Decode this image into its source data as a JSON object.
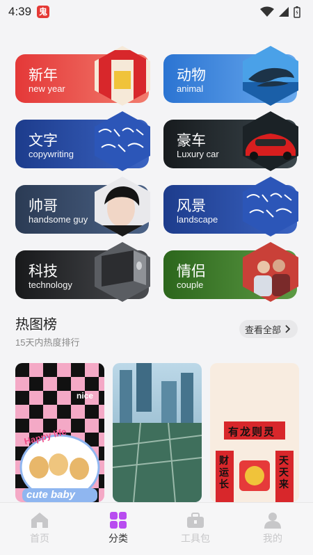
{
  "status_bar": {
    "time": "4:39",
    "app_icon_glyph": "鬼"
  },
  "categories": [
    {
      "title": "新年",
      "subtitle": "new year",
      "colors": [
        "#e63a3a",
        "#f08a7a"
      ],
      "image": "new-year-couplet"
    },
    {
      "title": "动物",
      "subtitle": "animal",
      "colors": [
        "#2f7ad6",
        "#6fb1f0"
      ],
      "image": "dolphin"
    },
    {
      "title": "文字",
      "subtitle": "copywriting",
      "colors": [
        "#1f3f8f",
        "#3c66c5"
      ],
      "image": "calligraphy"
    },
    {
      "title": "豪车",
      "subtitle": "Luxury car",
      "colors": [
        "#1a1f22",
        "#3f4a50"
      ],
      "image": "red-sports-car"
    },
    {
      "title": "帅哥",
      "subtitle": "handsome guy",
      "colors": [
        "#2d3d56",
        "#4a6183"
      ],
      "image": "portrait"
    },
    {
      "title": "风景",
      "subtitle": "landscape",
      "colors": [
        "#1f3f8f",
        "#3c66c5"
      ],
      "image": "calligraphy"
    },
    {
      "title": "科技",
      "subtitle": "technology",
      "colors": [
        "#1b1c1e",
        "#4a4c50"
      ],
      "image": "laptop"
    },
    {
      "title": "情侣",
      "subtitle": "couple",
      "colors": [
        "#2f6a1e",
        "#5d9a44"
      ],
      "image": "couple-photo"
    }
  ],
  "hot": {
    "title": "热图榜",
    "subtitle": "15天内热度排行",
    "view_all": "查看全部",
    "cards": [
      {
        "name": "puppies-checker",
        "caption_top": "nice",
        "caption_mid": "Happy life",
        "caption_bottom": "cute baby"
      },
      {
        "name": "city-aerial"
      },
      {
        "name": "dragon-newyear",
        "banner": "有龙则灵",
        "left_scroll": "财运长",
        "right_scroll": "天天来"
      }
    ]
  },
  "nav": [
    {
      "label": "首页",
      "icon": "home-icon",
      "active": false
    },
    {
      "label": "分类",
      "icon": "grid-icon",
      "active": true
    },
    {
      "label": "工具包",
      "icon": "toolbox-icon",
      "active": false
    },
    {
      "label": "我的",
      "icon": "person-icon",
      "active": false
    }
  ],
  "colors": {
    "accent": "#b84cf0",
    "inactive": "#c7c7c9"
  }
}
